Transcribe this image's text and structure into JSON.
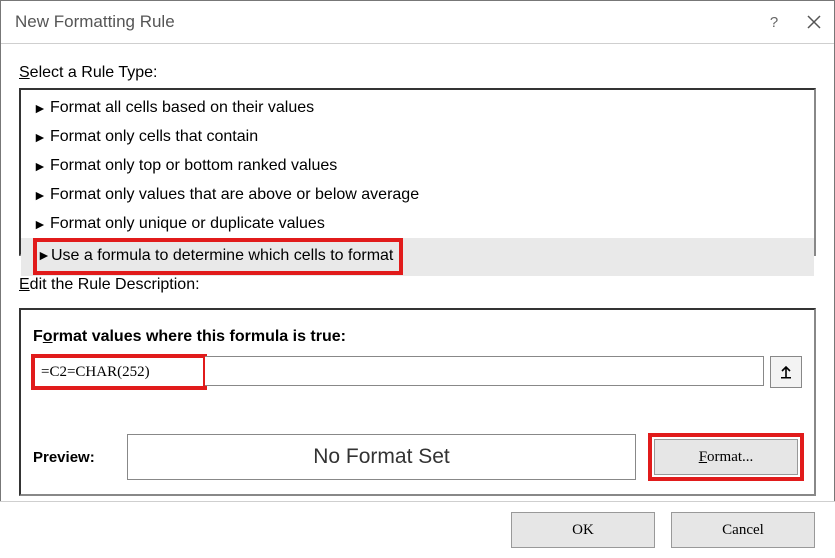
{
  "titlebar": {
    "title": "New Formatting Rule"
  },
  "labels": {
    "select_type": "Select a Rule Type:",
    "edit_desc": "Edit the Rule Description:",
    "formula_true": "Format values where this formula is true:",
    "preview": "Preview:",
    "preview_text": "No Format Set"
  },
  "rule_types": [
    "Format all cells based on their values",
    "Format only cells that contain",
    "Format only top or bottom ranked values",
    "Format only values that are above or below average",
    "Format only unique or duplicate values",
    "Use a formula to determine which cells to format"
  ],
  "formula": {
    "value": "=C2=CHAR(252)"
  },
  "buttons": {
    "format": "Format...",
    "ok": "OK",
    "cancel": "Cancel"
  }
}
